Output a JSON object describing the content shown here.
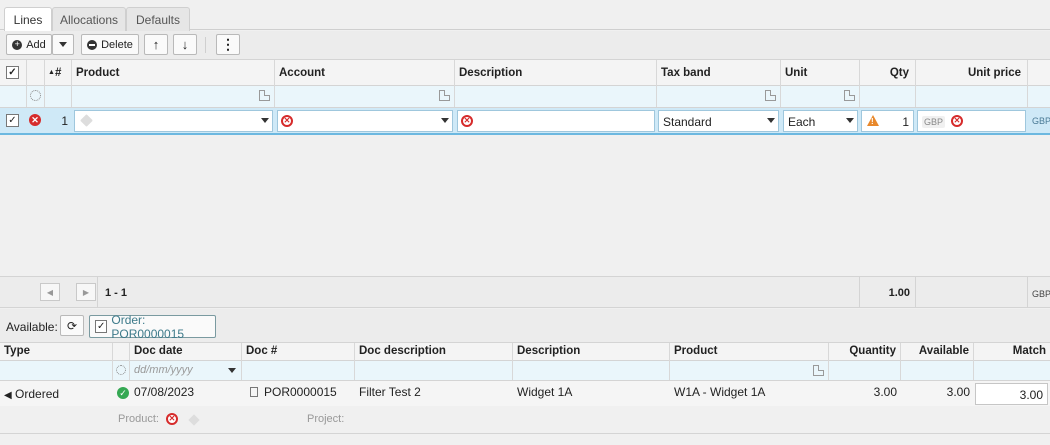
{
  "tabs": [
    {
      "label": "Lines",
      "active": true
    },
    {
      "label": "Allocations",
      "active": false
    },
    {
      "label": "Defaults",
      "active": false
    }
  ],
  "toolbar": {
    "add_label": "Add",
    "delete_label": "Delete",
    "up_icon": "arrow-up-icon",
    "down_icon": "arrow-down-icon",
    "more_icon": "kebab-menu-icon"
  },
  "grid": {
    "columns": {
      "hash": "#",
      "product": "Product",
      "account": "Account",
      "description": "Description",
      "tax_band": "Tax band",
      "unit": "Unit",
      "qty": "Qty",
      "unit_price": "Unit price"
    },
    "row": {
      "line_no": "1",
      "product": "",
      "account": "",
      "description": "",
      "tax_band": "Standard",
      "unit": "Each",
      "qty": "1",
      "currency": "GBP",
      "currency_overflow": "GBP"
    },
    "footer": {
      "page_range": "1 - 1",
      "qty_total": "1.00",
      "currency": "GBP"
    }
  },
  "available": {
    "label": "Available:",
    "order_filter": "Order: POR0000015",
    "columns": {
      "type": "Type",
      "doc_date": "Doc date",
      "doc_no": "Doc #",
      "doc_description": "Doc description",
      "description": "Description",
      "product": "Product",
      "quantity": "Quantity",
      "available": "Available",
      "match": "Match"
    },
    "date_placeholder": "dd/mm/yyyy",
    "rows": [
      {
        "type": "Ordered",
        "doc_date": "07/08/2023",
        "doc_no": "POR0000015",
        "doc_description": "Filter Test 2",
        "description": "Widget 1A",
        "product": "W1A - Widget 1A",
        "quantity": "3.00",
        "available": "3.00",
        "match": "3.00"
      }
    ],
    "detail": {
      "product_label": "Product:",
      "project_label": "Project:"
    }
  },
  "colors": {
    "selected_row": "#cfe9f7",
    "filter_row": "#eaf6fb",
    "error": "#d62b2b",
    "warning": "#e8882b",
    "ok": "#35a853"
  }
}
